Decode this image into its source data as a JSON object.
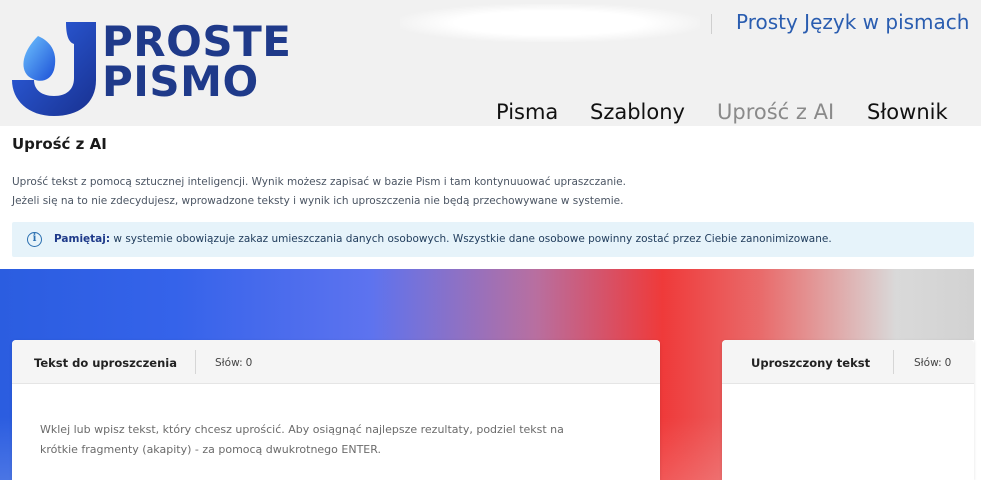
{
  "brand": {
    "line1": "PROSTE",
    "line2": "PISMO",
    "tagline": "Prosty Język w pismach"
  },
  "nav": {
    "items": [
      {
        "label": "Pisma"
      },
      {
        "label": "Szablony"
      },
      {
        "label": "Uprość z AI",
        "active": true
      },
      {
        "label": "Słownik"
      }
    ]
  },
  "page": {
    "title": "Uprość z AI",
    "description_1": "Uprość tekst z pomocą sztucznej inteligencji. Wynik możesz zapisać w bazie Pism i tam kontynuuować upraszczanie.",
    "description_2": "Jeżeli się na to nie zdecydujesz, wprowadzone teksty i wynik ich uproszczenia nie będą przechowywane w systemie."
  },
  "banner": {
    "icon": "info-icon",
    "icon_glyph": "i",
    "strong": "Pamiętaj:",
    "text": " w systemie obowiązuje zakaz umieszczania danych osobowych. Wszystkie dane osobowe powinny zostać przez Ciebie zanonimizowane."
  },
  "input_card": {
    "title": "Tekst do uproszczenia",
    "count_label": "Słów:",
    "count_value": "0",
    "placeholder": "Wklej lub wpisz tekst, który chcesz uprościć. Aby osiągnąć najlepsze rezultaty, podziel tekst na krótkie fragmenty (akapity) - za pomocą dwukrotnego ENTER."
  },
  "output_card": {
    "title": "Uproszczony tekst",
    "count_label": "Słów:",
    "count_value": "0"
  },
  "colors": {
    "brand_blue": "#1f3a8a",
    "accent_blue": "#2a5db0",
    "banner_bg": "#e6f3fa"
  }
}
